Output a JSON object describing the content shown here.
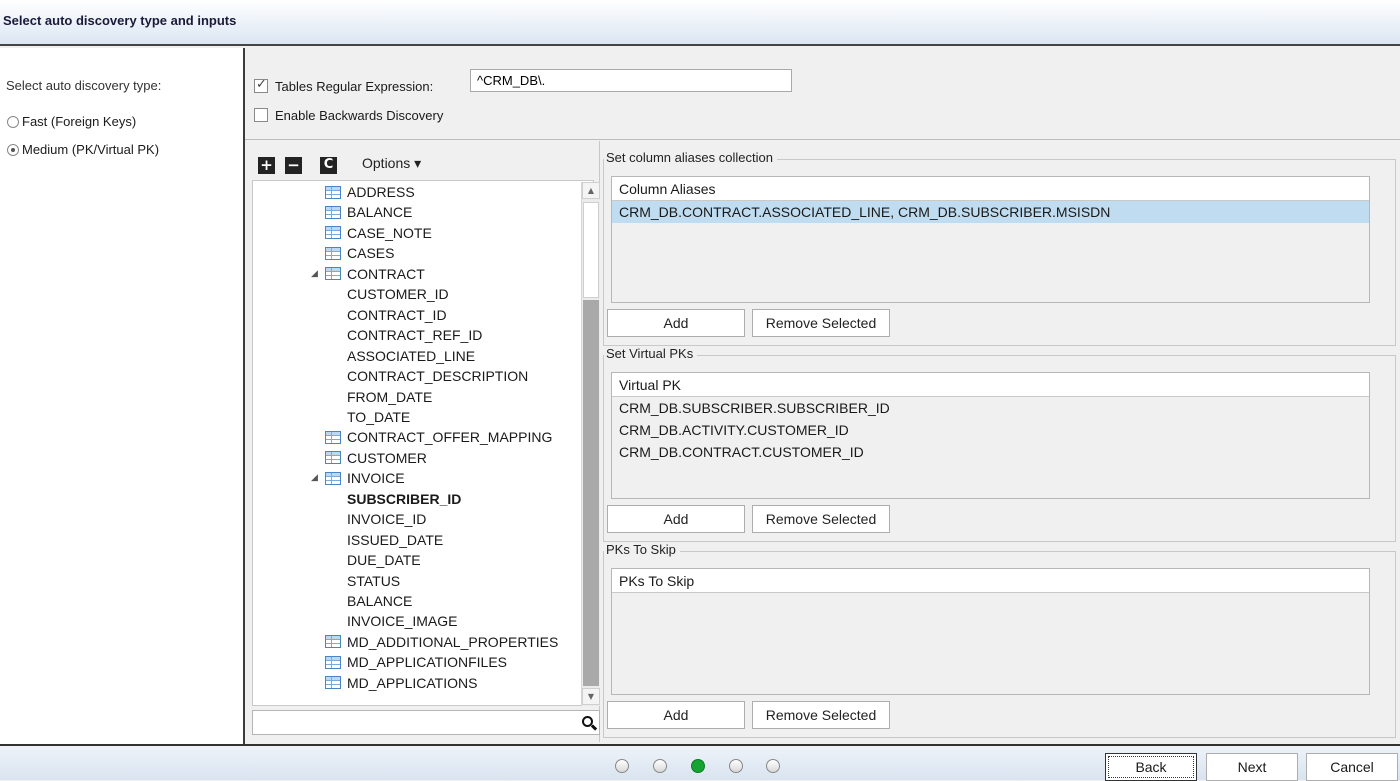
{
  "window": {
    "title": "Select auto discovery type and inputs"
  },
  "discovery_type": {
    "label": "Select auto discovery type:",
    "options": [
      {
        "label": "Fast (Foreign Keys)",
        "selected": false
      },
      {
        "label": "Medium (PK/Virtual PK)",
        "selected": true
      }
    ]
  },
  "tables_regex": {
    "label": "Tables Regular Expression:",
    "checked": true,
    "value": "^CRM_DB\\."
  },
  "backwards": {
    "label": "Enable Backwards Discovery",
    "checked": false
  },
  "tree_toolbar": {
    "expand_icon": "plus-icon",
    "collapse_icon": "minus-icon",
    "refresh_icon": "refresh-icon",
    "options_label": "Options ▾"
  },
  "tree": {
    "items": [
      {
        "label": "ADDRESS",
        "type": "table"
      },
      {
        "label": "BALANCE",
        "type": "table"
      },
      {
        "label": "CASE_NOTE",
        "type": "table"
      },
      {
        "label": "CASES",
        "type": "table"
      },
      {
        "label": "CONTRACT",
        "type": "table",
        "expanded": true
      },
      {
        "label": "CUSTOMER_ID",
        "type": "column"
      },
      {
        "label": "CONTRACT_ID",
        "type": "column"
      },
      {
        "label": "CONTRACT_REF_ID",
        "type": "column"
      },
      {
        "label": "ASSOCIATED_LINE",
        "type": "column"
      },
      {
        "label": "CONTRACT_DESCRIPTION",
        "type": "column"
      },
      {
        "label": "FROM_DATE",
        "type": "column"
      },
      {
        "label": "TO_DATE",
        "type": "column"
      },
      {
        "label": "CONTRACT_OFFER_MAPPING",
        "type": "table"
      },
      {
        "label": "CUSTOMER",
        "type": "table"
      },
      {
        "label": "INVOICE",
        "type": "table",
        "expanded": true
      },
      {
        "label": "SUBSCRIBER_ID",
        "type": "column",
        "bold": true
      },
      {
        "label": "INVOICE_ID",
        "type": "column"
      },
      {
        "label": "ISSUED_DATE",
        "type": "column"
      },
      {
        "label": "DUE_DATE",
        "type": "column"
      },
      {
        "label": "STATUS",
        "type": "column"
      },
      {
        "label": "BALANCE",
        "type": "column"
      },
      {
        "label": "INVOICE_IMAGE",
        "type": "column"
      },
      {
        "label": "MD_ADDITIONAL_PROPERTIES",
        "type": "table"
      },
      {
        "label": "MD_APPLICATIONFILES",
        "type": "table"
      },
      {
        "label": "MD_APPLICATIONS",
        "type": "table"
      }
    ],
    "search_value": ""
  },
  "aliases": {
    "legend": "Set column aliases collection",
    "header": "Column Aliases",
    "rows": [
      "CRM_DB.CONTRACT.ASSOCIATED_LINE,  CRM_DB.SUBSCRIBER.MSISDN"
    ],
    "add_label": "Add",
    "remove_label": "Remove Selected"
  },
  "virtual_pks": {
    "legend": "Set Virtual PKs",
    "header": "Virtual PK",
    "rows": [
      "CRM_DB.SUBSCRIBER.SUBSCRIBER_ID",
      "CRM_DB.ACTIVITY.CUSTOMER_ID",
      "CRM_DB.CONTRACT.CUSTOMER_ID"
    ],
    "add_label": "Add",
    "remove_label": "Remove Selected"
  },
  "pks_skip": {
    "legend": "PKs To Skip",
    "header": "PKs To Skip",
    "rows": [],
    "add_label": "Add",
    "remove_label": "Remove Selected"
  },
  "wizard": {
    "steps": 5,
    "current_step": 3
  },
  "nav": {
    "back": "Back",
    "next": "Next",
    "cancel": "Cancel"
  },
  "colors": {
    "selected_row": "#bfdcf0",
    "step_active": "#15a331"
  }
}
